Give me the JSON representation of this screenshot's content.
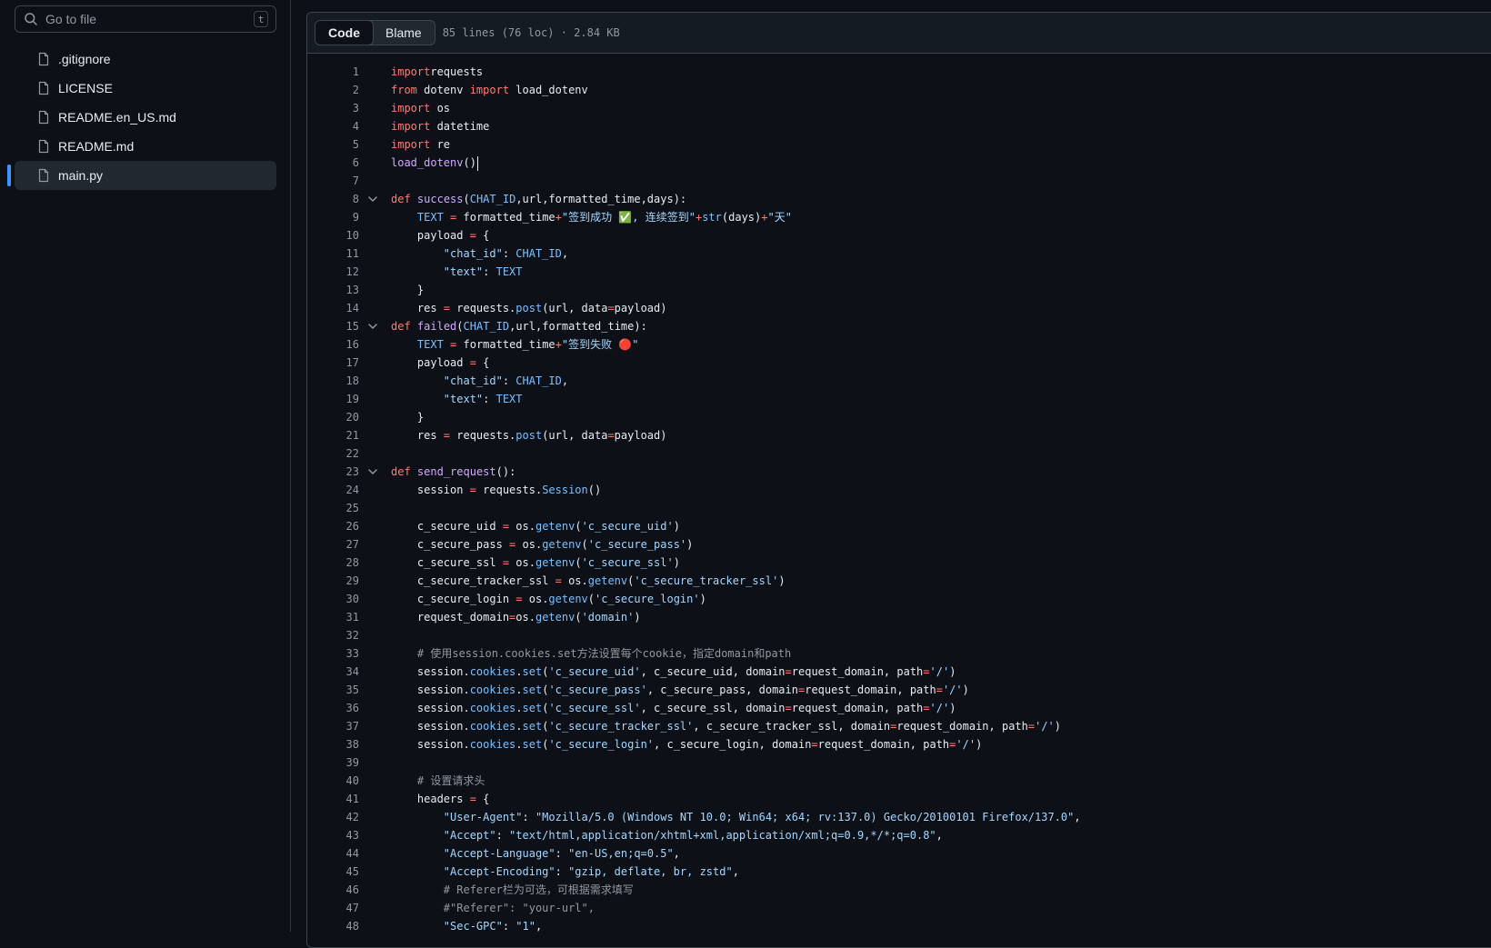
{
  "sidebar": {
    "search_placeholder": "Go to file",
    "search_shortcut": "t",
    "files": [
      {
        "name": ".gitignore",
        "active": false
      },
      {
        "name": "LICENSE",
        "active": false
      },
      {
        "name": "README.en_US.md",
        "active": false
      },
      {
        "name": "README.md",
        "active": false
      },
      {
        "name": "main.py",
        "active": true
      }
    ]
  },
  "viewer": {
    "tabs": [
      {
        "label": "Code",
        "active": true
      },
      {
        "label": "Blame",
        "active": false
      }
    ],
    "meta": "85 lines (76 loc) · 2.84 KB"
  },
  "code": {
    "fold_lines": [
      8,
      15,
      23
    ],
    "caret_line": 6,
    "lines": [
      [
        [
          "k",
          "import"
        ],
        [
          "",
          "requests"
        ]
      ],
      [
        [
          "k",
          "from"
        ],
        [
          "",
          " dotenv "
        ],
        [
          "k",
          "import"
        ],
        [
          "",
          " load_dotenv"
        ]
      ],
      [
        [
          "k",
          "import"
        ],
        [
          "",
          " os"
        ]
      ],
      [
        [
          "k",
          "import"
        ],
        [
          "",
          " datetime"
        ]
      ],
      [
        [
          "k",
          "import"
        ],
        [
          "",
          " re"
        ]
      ],
      [
        [
          "f",
          "load_dotenv"
        ],
        [
          "",
          "()"
        ]
      ],
      [],
      [
        [
          "k",
          "def"
        ],
        [
          "",
          " "
        ],
        [
          "f",
          "success"
        ],
        [
          "",
          "("
        ],
        [
          "c",
          "CHAT_ID"
        ],
        [
          "",
          ",url,formatted_time,days):"
        ]
      ],
      [
        [
          "",
          "    "
        ],
        [
          "c",
          "TEXT"
        ],
        [
          "",
          " "
        ],
        [
          "k",
          "="
        ],
        [
          "",
          " formatted_time"
        ],
        [
          "k",
          "+"
        ],
        [
          "s",
          "\"签到成功 ✅, 连续签到\""
        ],
        [
          "k",
          "+"
        ],
        [
          "c",
          "str"
        ],
        [
          "",
          "(days)"
        ],
        [
          "k",
          "+"
        ],
        [
          "s",
          "\"天\""
        ]
      ],
      [
        [
          "",
          "    payload "
        ],
        [
          "k",
          "="
        ],
        [
          "",
          " {"
        ]
      ],
      [
        [
          "",
          "        "
        ],
        [
          "s",
          "\"chat_id\""
        ],
        [
          "",
          ": "
        ],
        [
          "c",
          "CHAT_ID"
        ],
        [
          "",
          ","
        ]
      ],
      [
        [
          "",
          "        "
        ],
        [
          "s",
          "\"text\""
        ],
        [
          "",
          ": "
        ],
        [
          "c",
          "TEXT"
        ]
      ],
      [
        [
          "",
          "    }"
        ]
      ],
      [
        [
          "",
          "    res "
        ],
        [
          "k",
          "="
        ],
        [
          "",
          " requests."
        ],
        [
          "c",
          "post"
        ],
        [
          "",
          "(url, data"
        ],
        [
          "k",
          "="
        ],
        [
          "",
          "payload)"
        ]
      ],
      [
        [
          "k",
          "def"
        ],
        [
          "",
          " "
        ],
        [
          "f",
          "failed"
        ],
        [
          "",
          "("
        ],
        [
          "c",
          "CHAT_ID"
        ],
        [
          "",
          ",url,formatted_time):"
        ]
      ],
      [
        [
          "",
          "    "
        ],
        [
          "c",
          "TEXT"
        ],
        [
          "",
          " "
        ],
        [
          "k",
          "="
        ],
        [
          "",
          " formatted_time"
        ],
        [
          "k",
          "+"
        ],
        [
          "s",
          "\"签到失败 🔴\""
        ]
      ],
      [
        [
          "",
          "    payload "
        ],
        [
          "k",
          "="
        ],
        [
          "",
          " {"
        ]
      ],
      [
        [
          "",
          "        "
        ],
        [
          "s",
          "\"chat_id\""
        ],
        [
          "",
          ": "
        ],
        [
          "c",
          "CHAT_ID"
        ],
        [
          "",
          ","
        ]
      ],
      [
        [
          "",
          "        "
        ],
        [
          "s",
          "\"text\""
        ],
        [
          "",
          ": "
        ],
        [
          "c",
          "TEXT"
        ]
      ],
      [
        [
          "",
          "    }"
        ]
      ],
      [
        [
          "",
          "    res "
        ],
        [
          "k",
          "="
        ],
        [
          "",
          " requests."
        ],
        [
          "c",
          "post"
        ],
        [
          "",
          "(url, data"
        ],
        [
          "k",
          "="
        ],
        [
          "",
          "payload)"
        ]
      ],
      [],
      [
        [
          "k",
          "def"
        ],
        [
          "",
          " "
        ],
        [
          "f",
          "send_request"
        ],
        [
          "",
          "():"
        ]
      ],
      [
        [
          "",
          "    session "
        ],
        [
          "k",
          "="
        ],
        [
          "",
          " requests."
        ],
        [
          "c",
          "Session"
        ],
        [
          "",
          "()"
        ]
      ],
      [],
      [
        [
          "",
          "    c_secure_uid "
        ],
        [
          "k",
          "="
        ],
        [
          "",
          " os."
        ],
        [
          "c",
          "getenv"
        ],
        [
          "",
          "("
        ],
        [
          "s",
          "'c_secure_uid'"
        ],
        [
          "",
          ")"
        ]
      ],
      [
        [
          "",
          "    c_secure_pass "
        ],
        [
          "k",
          "="
        ],
        [
          "",
          " os."
        ],
        [
          "c",
          "getenv"
        ],
        [
          "",
          "("
        ],
        [
          "s",
          "'c_secure_pass'"
        ],
        [
          "",
          ")"
        ]
      ],
      [
        [
          "",
          "    c_secure_ssl "
        ],
        [
          "k",
          "="
        ],
        [
          "",
          " os."
        ],
        [
          "c",
          "getenv"
        ],
        [
          "",
          "("
        ],
        [
          "s",
          "'c_secure_ssl'"
        ],
        [
          "",
          ")"
        ]
      ],
      [
        [
          "",
          "    c_secure_tracker_ssl "
        ],
        [
          "k",
          "="
        ],
        [
          "",
          " os."
        ],
        [
          "c",
          "getenv"
        ],
        [
          "",
          "("
        ],
        [
          "s",
          "'c_secure_tracker_ssl'"
        ],
        [
          "",
          ")"
        ]
      ],
      [
        [
          "",
          "    c_secure_login "
        ],
        [
          "k",
          "="
        ],
        [
          "",
          " os."
        ],
        [
          "c",
          "getenv"
        ],
        [
          "",
          "("
        ],
        [
          "s",
          "'c_secure_login'"
        ],
        [
          "",
          ")"
        ]
      ],
      [
        [
          "",
          "    request_domain"
        ],
        [
          "k",
          "="
        ],
        [
          "",
          "os."
        ],
        [
          "c",
          "getenv"
        ],
        [
          "",
          "("
        ],
        [
          "s",
          "'domain'"
        ],
        [
          "",
          ")"
        ]
      ],
      [],
      [
        [
          "",
          "    "
        ],
        [
          "m",
          "# 使用session.cookies.set方法设置每个cookie，指定domain和path"
        ]
      ],
      [
        [
          "",
          "    session."
        ],
        [
          "c",
          "cookies"
        ],
        [
          "",
          "."
        ],
        [
          "c",
          "set"
        ],
        [
          "",
          "("
        ],
        [
          "s",
          "'c_secure_uid'"
        ],
        [
          "",
          ", c_secure_uid, domain"
        ],
        [
          "k",
          "="
        ],
        [
          "",
          "request_domain, path"
        ],
        [
          "k",
          "="
        ],
        [
          "s",
          "'/'"
        ],
        [
          "",
          ")"
        ]
      ],
      [
        [
          "",
          "    session."
        ],
        [
          "c",
          "cookies"
        ],
        [
          "",
          "."
        ],
        [
          "c",
          "set"
        ],
        [
          "",
          "("
        ],
        [
          "s",
          "'c_secure_pass'"
        ],
        [
          "",
          ", c_secure_pass, domain"
        ],
        [
          "k",
          "="
        ],
        [
          "",
          "request_domain, path"
        ],
        [
          "k",
          "="
        ],
        [
          "s",
          "'/'"
        ],
        [
          "",
          ")"
        ]
      ],
      [
        [
          "",
          "    session."
        ],
        [
          "c",
          "cookies"
        ],
        [
          "",
          "."
        ],
        [
          "c",
          "set"
        ],
        [
          "",
          "("
        ],
        [
          "s",
          "'c_secure_ssl'"
        ],
        [
          "",
          ", c_secure_ssl, domain"
        ],
        [
          "k",
          "="
        ],
        [
          "",
          "request_domain, path"
        ],
        [
          "k",
          "="
        ],
        [
          "s",
          "'/'"
        ],
        [
          "",
          ")"
        ]
      ],
      [
        [
          "",
          "    session."
        ],
        [
          "c",
          "cookies"
        ],
        [
          "",
          "."
        ],
        [
          "c",
          "set"
        ],
        [
          "",
          "("
        ],
        [
          "s",
          "'c_secure_tracker_ssl'"
        ],
        [
          "",
          ", c_secure_tracker_ssl, domain"
        ],
        [
          "k",
          "="
        ],
        [
          "",
          "request_domain, path"
        ],
        [
          "k",
          "="
        ],
        [
          "s",
          "'/'"
        ],
        [
          "",
          ")"
        ]
      ],
      [
        [
          "",
          "    session."
        ],
        [
          "c",
          "cookies"
        ],
        [
          "",
          "."
        ],
        [
          "c",
          "set"
        ],
        [
          "",
          "("
        ],
        [
          "s",
          "'c_secure_login'"
        ],
        [
          "",
          ", c_secure_login, domain"
        ],
        [
          "k",
          "="
        ],
        [
          "",
          "request_domain, path"
        ],
        [
          "k",
          "="
        ],
        [
          "s",
          "'/'"
        ],
        [
          "",
          ")"
        ]
      ],
      [],
      [
        [
          "",
          "    "
        ],
        [
          "m",
          "# 设置请求头"
        ]
      ],
      [
        [
          "",
          "    headers "
        ],
        [
          "k",
          "="
        ],
        [
          "",
          " {"
        ]
      ],
      [
        [
          "",
          "        "
        ],
        [
          "s",
          "\"User-Agent\""
        ],
        [
          "",
          ": "
        ],
        [
          "s",
          "\"Mozilla/5.0 (Windows NT 10.0; Win64; x64; rv:137.0) Gecko/20100101 Firefox/137.0\""
        ],
        [
          "",
          ","
        ]
      ],
      [
        [
          "",
          "        "
        ],
        [
          "s",
          "\"Accept\""
        ],
        [
          "",
          ": "
        ],
        [
          "s",
          "\"text/html,application/xhtml+xml,application/xml;q=0.9,*/*;q=0.8\""
        ],
        [
          "",
          ","
        ]
      ],
      [
        [
          "",
          "        "
        ],
        [
          "s",
          "\"Accept-Language\""
        ],
        [
          "",
          ": "
        ],
        [
          "s",
          "\"en-US,en;q=0.5\""
        ],
        [
          "",
          ","
        ]
      ],
      [
        [
          "",
          "        "
        ],
        [
          "s",
          "\"Accept-Encoding\""
        ],
        [
          "",
          ": "
        ],
        [
          "s",
          "\"gzip, deflate, br, zstd\""
        ],
        [
          "",
          ","
        ]
      ],
      [
        [
          "",
          "        "
        ],
        [
          "m",
          "# Referer栏为可选，可根据需求填写"
        ]
      ],
      [
        [
          "",
          "        "
        ],
        [
          "m",
          "#\"Referer\": \"your-url\","
        ]
      ],
      [
        [
          "",
          "        "
        ],
        [
          "s",
          "\"Sec-GPC\""
        ],
        [
          "",
          ": "
        ],
        [
          "s",
          "\"1\""
        ],
        [
          "",
          ","
        ]
      ]
    ]
  }
}
